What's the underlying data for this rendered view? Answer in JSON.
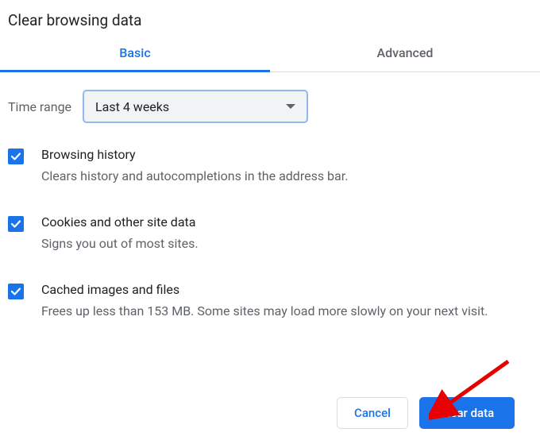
{
  "title": "Clear browsing data",
  "tabs": {
    "basic": "Basic",
    "advanced": "Advanced"
  },
  "time_range": {
    "label": "Time range",
    "selected": "Last 4 weeks"
  },
  "options": [
    {
      "title": "Browsing history",
      "desc": "Clears history and autocompletions in the address bar.",
      "checked": true
    },
    {
      "title": "Cookies and other site data",
      "desc": "Signs you out of most sites.",
      "checked": true
    },
    {
      "title": "Cached images and files",
      "desc": "Frees up less than 153 MB. Some sites may load more slowly on your next visit.",
      "checked": true
    }
  ],
  "buttons": {
    "cancel": "Cancel",
    "clear": "Clear data"
  }
}
